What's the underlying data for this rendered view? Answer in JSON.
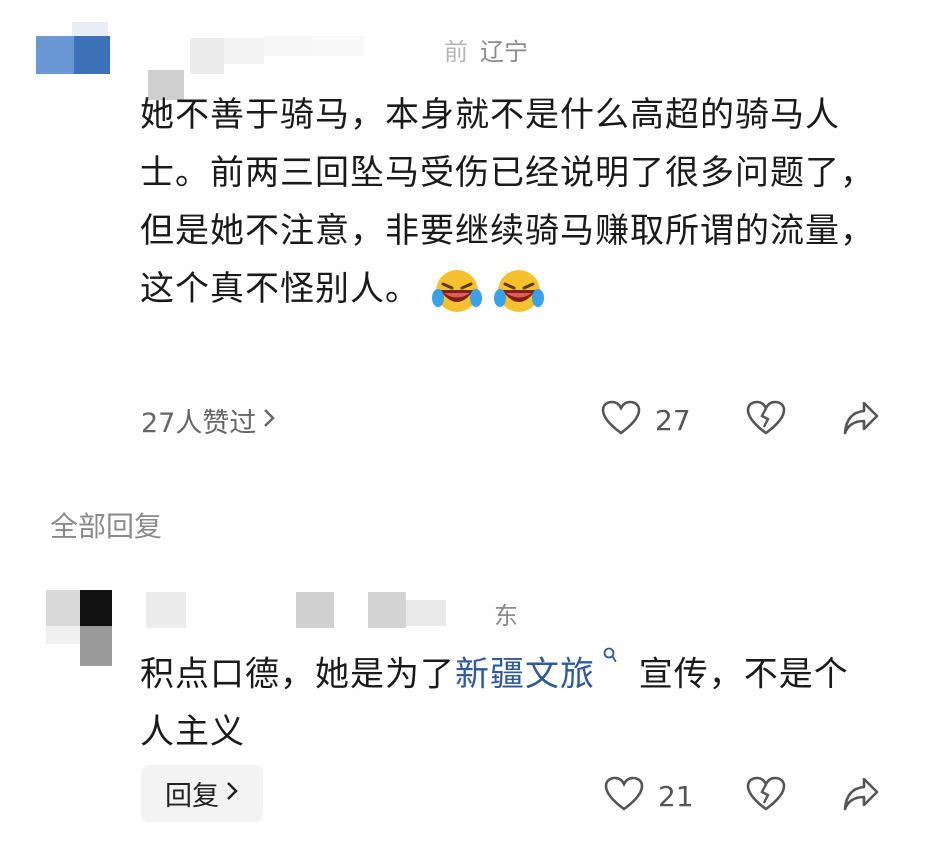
{
  "main_comment": {
    "location": "辽宁",
    "time_fragment": "前",
    "text": "她不善于骑马，本身就不是什么高超的骑马人士。前两三回坠马受伤已经说明了很多问题了，但是她不注意，非要继续骑马赚取所谓的流量，这个真不怪别人。",
    "emoji_name": "laughing-crying-emoji",
    "liked_by": "27人赞过",
    "like_count": "27"
  },
  "replies_section": {
    "title": "全部回复"
  },
  "reply": {
    "location_fragment": "东",
    "text_before": "积点口德，她是为了",
    "link_text": "新疆文旅",
    "text_after": "宣传，不是个人主义",
    "reply_button_label": "回复",
    "like_count": "21"
  },
  "icons": {
    "like": "heart-icon",
    "dislike": "broken-heart-icon",
    "share": "share-icon",
    "chevron": "chevron-right-icon",
    "search": "search-icon"
  },
  "colors": {
    "link": "#2f5a9e",
    "muted": "#8a8a8a",
    "button_bg": "#f3f3f3"
  }
}
